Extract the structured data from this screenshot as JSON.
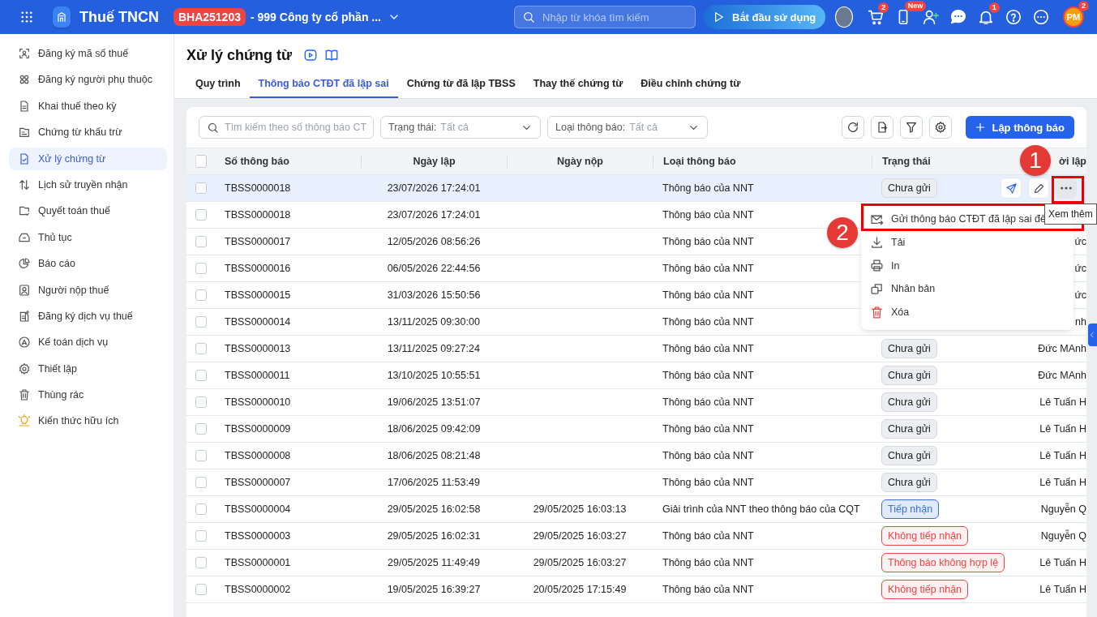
{
  "topbar": {
    "app_name": "Thuế TNCN",
    "org_code": "BHA251203",
    "org_name": "- 999 Công ty cổ phần ...",
    "search": {
      "placeholder": "Nhập từ khóa tìm kiếm"
    },
    "start_button": "Bắt đầu sử dụng",
    "cart_badge": "2",
    "phone_badge": "New",
    "bell_badge": "1",
    "avatar_initials": "PM",
    "avatar_badge": "2"
  },
  "sidebar": {
    "items": [
      {
        "label": "Đăng ký mã số thuế",
        "selected": false
      },
      {
        "label": "Đăng ký người phụ thuộc",
        "selected": false
      },
      {
        "label": "Khai thuế theo kỳ",
        "selected": false
      },
      {
        "label": "Chứng từ khấu trừ",
        "selected": false
      },
      {
        "label": "Xử lý chứng từ",
        "selected": true
      },
      {
        "label": "Lịch sử truyền nhận",
        "selected": false
      },
      {
        "label": "Quyết toán thuế",
        "selected": false
      },
      {
        "label": "Thủ tục",
        "selected": false
      },
      {
        "label": "Báo cáo",
        "selected": false
      },
      {
        "label": "Người nộp thuế",
        "selected": false
      },
      {
        "label": "Đăng ký dịch vụ thuế",
        "selected": false
      },
      {
        "label": "Kế toán dịch vụ",
        "selected": false
      },
      {
        "label": "Thiết lập",
        "selected": false
      },
      {
        "label": "Thùng rác",
        "selected": false
      },
      {
        "label": "Kiến thức hữu ích",
        "selected": false
      }
    ]
  },
  "page": {
    "title": "Xử lý chứng từ",
    "tabs": [
      {
        "label": "Quy trình",
        "selected": false
      },
      {
        "label": "Thông báo CTĐT đã lập sai",
        "selected": true
      },
      {
        "label": "Chứng từ đã lập TBSS",
        "selected": false
      },
      {
        "label": "Thay thế chứng từ",
        "selected": false
      },
      {
        "label": "Điều chỉnh chứng từ",
        "selected": false
      }
    ]
  },
  "toolbar": {
    "search": {
      "placeholder": "Tìm kiếm theo số thông báo CT"
    },
    "filters": [
      {
        "label": "Trạng thái:",
        "value": "Tất cả"
      },
      {
        "label": "Loại thông báo:",
        "value": "Tất cả"
      }
    ],
    "create_button": "Lập thông báo"
  },
  "table": {
    "columns": [
      "Số thông báo",
      "Ngày lập",
      "Ngày nộp",
      "Loại thông báo",
      "Trạng thái",
      "ời lập"
    ],
    "header_checked": false,
    "rows": [
      {
        "number": "TBSS0000018",
        "created": "23/07/2026 17:24:01",
        "type": "Thông báo của NNT",
        "status": {
          "label": "Chưa gửi",
          "kind": "pending"
        },
        "checked": false,
        "selected": true,
        "hovered": true
      },
      {
        "number": "TBSS0000018",
        "created": "23/07/2026 17:24:01",
        "type": "Thông báo của NNT",
        "checked": false,
        "selected": false,
        "hovered": false
      },
      {
        "number": "TBSS0000017",
        "created": "12/05/2026 08:56:26",
        "type": "Thông báo của NNT",
        "creator": "ức",
        "checked": false,
        "selected": false,
        "hovered": false
      },
      {
        "number": "TBSS0000016",
        "created": "06/05/2026 22:44:56",
        "type": "Thông báo của NNT",
        "creator": "ức",
        "checked": false,
        "selected": false,
        "hovered": false
      },
      {
        "number": "TBSS0000015",
        "created": "31/03/2026 15:50:56",
        "type": "Thông báo của NNT",
        "creator": "ức",
        "checked": false,
        "selected": false,
        "hovered": false
      },
      {
        "number": "TBSS0000014",
        "created": "13/11/2025 09:30:00",
        "type": "Thông báo của NNT",
        "creator": "nh",
        "checked": false,
        "selected": false,
        "hovered": false
      },
      {
        "number": "TBSS0000013",
        "created": "13/11/2025 09:27:24",
        "type": "Thông báo của NNT",
        "status": {
          "label": "Chưa gửi",
          "kind": "pending"
        },
        "creator": "Đức MAnh",
        "checked": false,
        "selected": false,
        "hovered": false
      },
      {
        "number": "TBSS0000011",
        "created": "13/10/2025 10:55:51",
        "type": "Thông báo của NNT",
        "status": {
          "label": "Chưa gửi",
          "kind": "pending"
        },
        "creator": "Đức MAnh",
        "checked": false,
        "selected": false,
        "hovered": false
      },
      {
        "number": "TBSS0000010",
        "created": "19/06/2025 13:51:07",
        "type": "Thông báo của NNT",
        "status": {
          "label": "Chưa gửi",
          "kind": "pending"
        },
        "creator": "Lê Tuấn H",
        "checked": false,
        "selected": false,
        "hovered": false
      },
      {
        "number": "TBSS0000009",
        "created": "18/06/2025 09:42:09",
        "type": "Thông báo của NNT",
        "status": {
          "label": "Chưa gửi",
          "kind": "pending"
        },
        "creator": "Lê Tuấn H",
        "checked": false,
        "selected": false,
        "hovered": false
      },
      {
        "number": "TBSS0000008",
        "created": "18/06/2025 08:21:48",
        "type": "Thông báo của NNT",
        "status": {
          "label": "Chưa gửi",
          "kind": "pending"
        },
        "creator": "Lê Tuấn H",
        "checked": false,
        "selected": false,
        "hovered": false
      },
      {
        "number": "TBSS0000007",
        "created": "17/06/2025 11:53:49",
        "type": "Thông báo của NNT",
        "status": {
          "label": "Chưa gửi",
          "kind": "pending"
        },
        "creator": "Lê Tuấn H",
        "checked": false,
        "selected": false,
        "hovered": false
      },
      {
        "number": "TBSS0000004",
        "created": "29/05/2025 16:02:58",
        "submitted": "29/05/2025 16:03:13",
        "type": "Giải trình của NNT theo thông báo của CQT",
        "status": {
          "label": "Tiếp nhận",
          "kind": "accepted"
        },
        "creator": "Nguyễn Q",
        "checked": false,
        "selected": false,
        "hovered": false
      },
      {
        "number": "TBSS0000003",
        "created": "29/05/2025 16:02:31",
        "submitted": "29/05/2025 16:03:27",
        "type": "Thông báo của NNT",
        "status": {
          "label": "Không tiếp nhận",
          "kind": "rejected"
        },
        "creator": "Nguyễn Q",
        "checked": false,
        "selected": false,
        "hovered": false
      },
      {
        "number": "TBSS0000001",
        "created": "29/05/2025 11:49:49",
        "submitted": "29/05/2025 16:03:27",
        "type": "Thông báo của NNT",
        "status": {
          "label": "Thông báo không hợp lệ",
          "kind": "rejected"
        },
        "creator": "Lê Tuấn H",
        "checked": false,
        "selected": false,
        "hovered": false
      },
      {
        "number": "TBSS0000002",
        "created": "19/05/2025 16:39:27",
        "submitted": "20/05/2025 17:15:49",
        "type": "Thông báo của NNT",
        "status": {
          "label": "Không tiếp nhận",
          "kind": "rejected"
        },
        "creator": "Lê Tuấn H",
        "checked": false,
        "selected": false,
        "hovered": false
      }
    ]
  },
  "row_menu": {
    "items": [
      {
        "label": "Gửi thông báo CTĐT đã lập sai đế",
        "kind": "send"
      },
      {
        "label": "Tải",
        "kind": "download"
      },
      {
        "label": "In",
        "kind": "print"
      },
      {
        "label": "Nhân bản",
        "kind": "duplicate"
      },
      {
        "label": "Xóa",
        "kind": "delete"
      }
    ]
  },
  "tooltip": "Xem thêm",
  "annotations": [
    {
      "label": "1"
    },
    {
      "label": "2"
    }
  ]
}
